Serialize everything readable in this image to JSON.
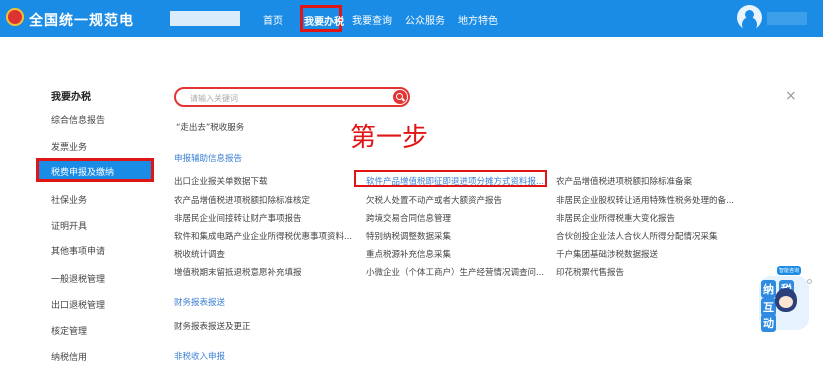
{
  "header": {
    "site_title": "全国统一规范电",
    "nav": [
      "首页",
      "我要办税",
      "我要查询",
      "公众服务",
      "地方特色"
    ],
    "active_nav": "我要办税"
  },
  "sidebar": {
    "heading": "我要办税",
    "items": [
      "综合信息报告",
      "发票业务",
      "税费申报及缴纳",
      "社保业务",
      "证明开具",
      "其他事项申请",
      "一般退税管理",
      "出口退税管理",
      "核定管理",
      "纳税信用"
    ],
    "active_item": "税费申报及缴纳"
  },
  "search": {
    "placeholder": "请输入关键词"
  },
  "close_symbol": "×",
  "annotation": "第一步",
  "quick_link": "“走出去”税收服务",
  "sections": [
    {
      "title": "申报辅助信息报告",
      "rows": [
        [
          "出口企业报关单数据下载",
          "软件产品增值税即征即退进项分摊方式资料报...",
          "农产品增值税进项税额扣除标准备案"
        ],
        [
          "农产品增值税进项税额扣除标准核定",
          "欠税人处置不动产或者大额资产报告",
          "非居民企业股权转让适用特殊性税务处理的备..."
        ],
        [
          "非居民企业间接转让财产事项报告",
          "跨境交易合同信息管理",
          "非居民企业所得税重大变化报告"
        ],
        [
          "软件和集成电路产业企业所得税优惠事项资料...",
          "特别纳税调整数据采集",
          "合伙创投企业法人合伙人所得分配情况采集"
        ],
        [
          "税收统计调查",
          "重点税源补充信息采集",
          "千户集团基础涉税数据报送"
        ],
        [
          "增值税期末留抵退税意愿补充填报",
          "小微企业（个体工商户）生产经营情况调查问...",
          "印花税票代售报告"
        ]
      ]
    },
    {
      "title": "财务报表报送",
      "rows": [
        [
          "财务报表报送及更正"
        ]
      ]
    },
    {
      "title": "非税收入申报",
      "rows": []
    }
  ],
  "assistant": {
    "tag": "智能咨询",
    "chars": [
      "纳",
      "税",
      "互",
      "动"
    ]
  }
}
